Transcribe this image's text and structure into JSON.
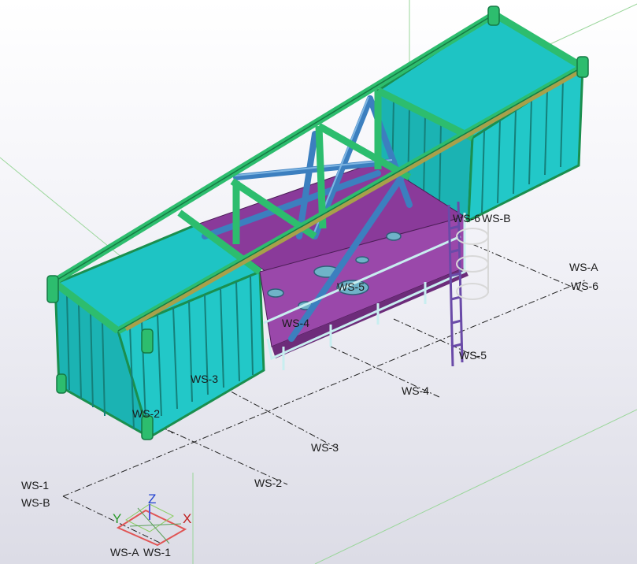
{
  "viewport": {
    "background_top": "#ffffff",
    "background_bottom": "#dcdce6"
  },
  "grid_labels": {
    "a": "WS-A",
    "b": "WS-B",
    "n1": "WS-1",
    "n2": "WS-2",
    "n3": "WS-3",
    "n4": "WS-4",
    "n5": "WS-5",
    "n6": "WS-6",
    "top_6": "WS-6",
    "top_b": "WS-B",
    "top_5": "WS-5",
    "top_4": "WS-4",
    "top_3": "WS-3",
    "top_2": "WS-2",
    "end_a": "WS-A",
    "end_6": "WS-6",
    "start_1": "WS-1",
    "start_b": "WS-B",
    "axis_a": "WS-A",
    "axis_1": "WS-1"
  },
  "axes": {
    "x": "X",
    "y": "Y",
    "z": "Z"
  },
  "colors": {
    "steel_green": "#2dbd6e",
    "steel_dark": "#1a8f4e",
    "panel_cyan": "#1ec4c4",
    "panel_cyan_light": "#55dada",
    "beam_blue": "#3c7fbf",
    "deck_purple": "#8a3a9a",
    "ladder_purple": "#6a4aa8",
    "beam_olive": "#a8a04a"
  }
}
